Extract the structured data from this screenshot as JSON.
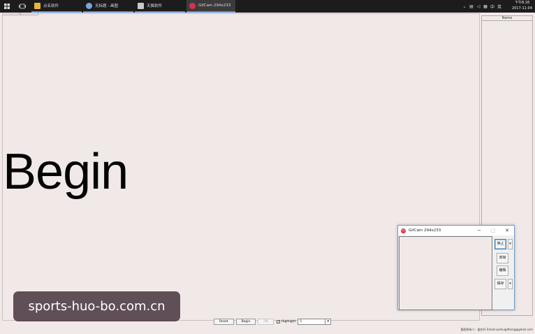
{
  "taskbar": {
    "tasks": [
      {
        "label": "点名软件",
        "color": "#e8b53a"
      },
      {
        "label": "无标题 - 画图",
        "color": "#7aa7d8"
      },
      {
        "label": "天猫软件",
        "color": "#c9c9c9"
      },
      {
        "label": "GifCam 294x233",
        "color": "#d8324c"
      }
    ],
    "tray_icons": [
      "chevron-up-icon",
      "network-icon",
      "volume-icon",
      "ime-icon",
      "keyboard-icon"
    ],
    "tray_ime": "英",
    "tray_lang": "中",
    "time": "下午8:18",
    "date": "2017-11-04"
  },
  "main": {
    "display_text": "Begin",
    "side_panel_header": "Name"
  },
  "toolbar": {
    "reset_label": "Reset",
    "begin_label": "Begin",
    "ok_label": "OK",
    "highlight_label": "Highlight",
    "highlight_checked": "✓",
    "combo_value": "5"
  },
  "footer": {
    "credit": "版权所有人：侯东升    Email:xuehuigdhong@gmail.com"
  },
  "gifcam": {
    "title": "GifCam 294x233",
    "logo_text": "GC",
    "buttons": {
      "stop": "停止",
      "single_frame": "单帧",
      "edit": "编辑",
      "save": "保存"
    },
    "controls": {
      "minimize": "−",
      "maximize": "□",
      "close": "✕"
    }
  },
  "watermark": {
    "text": "sports-huo-bo.com.cn"
  }
}
